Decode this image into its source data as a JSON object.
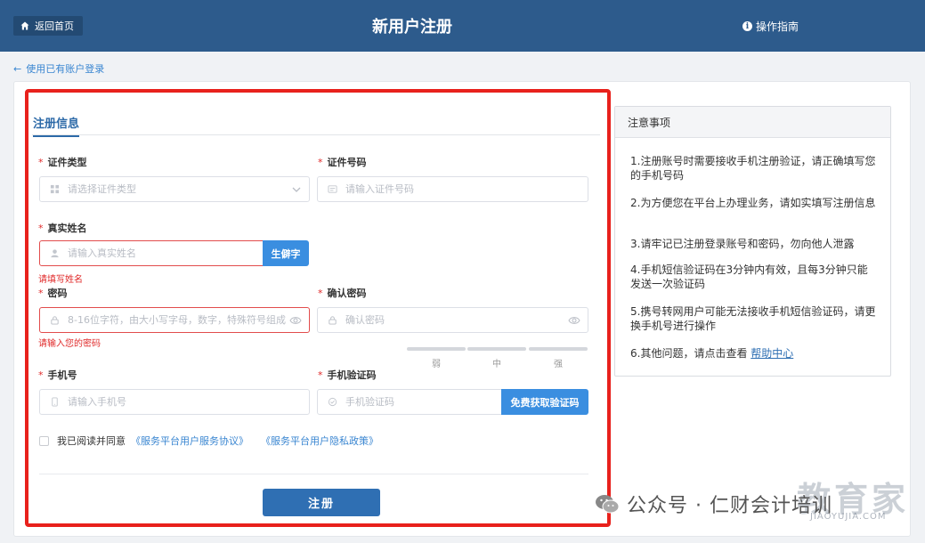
{
  "header": {
    "back_label": "返回首页",
    "title": "新用户注册",
    "guide_label": "操作指南"
  },
  "login_link": "使用已有账户登录",
  "form": {
    "tab": "注册信息",
    "id_type": {
      "label": "证件类型",
      "placeholder": "请选择证件类型"
    },
    "id_number": {
      "label": "证件号码",
      "placeholder": "请输入证件号码"
    },
    "real_name": {
      "label": "真实姓名",
      "placeholder": "请输入真实姓名",
      "button": "生僻字",
      "error": "请填写姓名"
    },
    "password": {
      "label": "密码",
      "placeholder": "8-16位字符，由大小写字母，数字，特殊符号组成",
      "error": "请输入您的密码"
    },
    "confirm_password": {
      "label": "确认密码",
      "placeholder": "确认密码"
    },
    "strength": [
      "弱",
      "中",
      "强"
    ],
    "phone": {
      "label": "手机号",
      "placeholder": "请输入手机号"
    },
    "sms_code": {
      "label": "手机验证码",
      "placeholder": "手机验证码",
      "button": "免费获取验证码"
    },
    "agree": {
      "text": "我已阅读并同意",
      "link1": "《服务平台用户服务协议》",
      "link2": "《服务平台用户隐私政策》"
    },
    "submit": "注册",
    "required_mark": "*"
  },
  "notice": {
    "title": "注意事项",
    "items": [
      "1.注册账号时需要接收手机注册验证，请正确填写您的手机号码",
      "2.为方便您在平台上办理业务，请如实填写注册信息",
      "3.请牢记已注册登录账号和密码，勿向他人泄露",
      "4.手机短信验证码在3分钟内有效，且每3分钟只能发送一次验证码",
      "5.携号转网用户可能无法接收手机短信验证码，请更换手机号进行操作"
    ],
    "item6_prefix": "6.其他问题，请点击查看 ",
    "help_link": "帮助中心"
  },
  "watermark": {
    "text": "公众号 · 仁财会计培训",
    "bg": "教育家",
    "sub": "JIAOYUJIA.COM"
  },
  "colors": {
    "header": "#2d5b8c",
    "accent": "#3a8ee0",
    "error": "#e02a2a",
    "highlight": "#e8211c"
  }
}
